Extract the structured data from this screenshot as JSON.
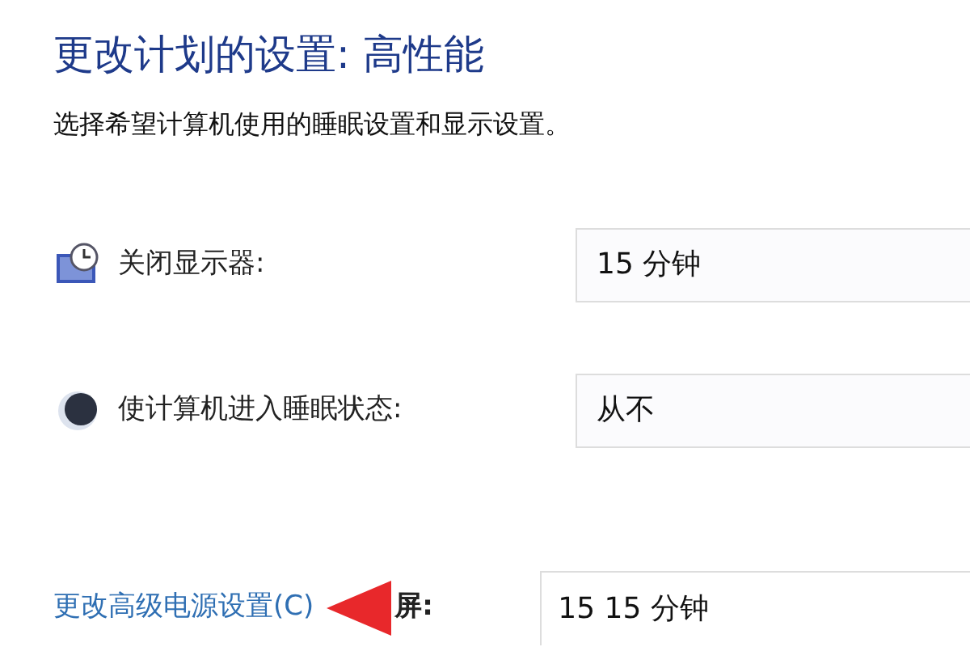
{
  "title": "更改计划的设置: 高性能",
  "subtitle": "选择希望计算机使用的睡眠设置和显示设置。",
  "settings": [
    {
      "kind": "display",
      "label": "关闭显示器:",
      "value": "15 分钟"
    },
    {
      "kind": "sleep",
      "label": "使计算机进入睡眠状态:",
      "value": "从不"
    }
  ],
  "advanced_link": "更改高级电源设置(C)",
  "overlay": {
    "label": "屏:",
    "value": "15 15 分钟"
  }
}
